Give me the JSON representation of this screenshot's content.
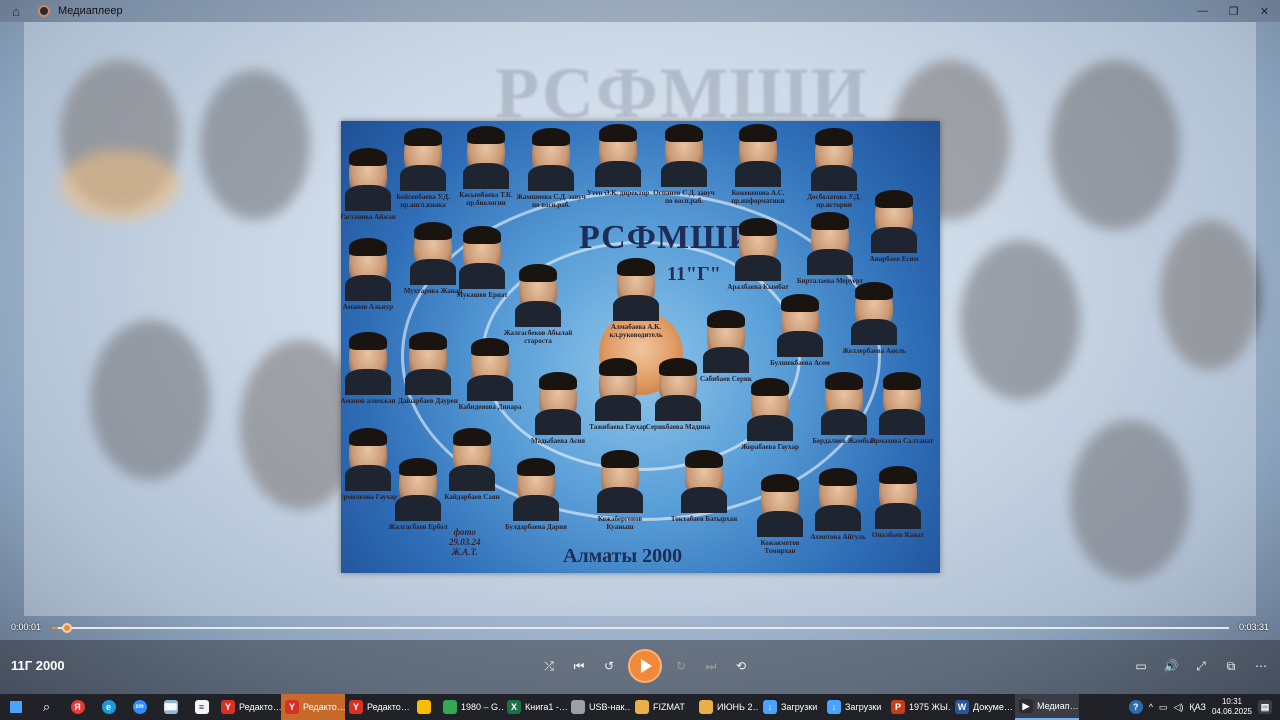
{
  "window": {
    "title": "Медиаплеер"
  },
  "photo": {
    "school": "РСФМШИ",
    "class": "11\"Г\"",
    "city": "Алматы 2000",
    "date_lines": [
      "фото",
      "29.03.24",
      "Ж.А.Т."
    ],
    "people": [
      {
        "name": "Гастанова Айжан"
      },
      {
        "name": "Бейсенбаева У.Д. пр.англ.языка"
      },
      {
        "name": "Касымбаева Т.К. пр.биологии"
      },
      {
        "name": "Жамшиева С.Д. завуч по восп.раб."
      },
      {
        "name": "Утен Ә.К. директор"
      },
      {
        "name": "Оспанов С.Д. завуч по восп.раб."
      },
      {
        "name": "Кожекенова А.С. пр.информатики"
      },
      {
        "name": "Досболатова У.Д. пр.истории"
      },
      {
        "name": "Анарбаев Есим"
      },
      {
        "name": "Аманов Альнур"
      },
      {
        "name": "Мухтарова Жанар"
      },
      {
        "name": "Мукашев Ернат"
      },
      {
        "name": "Жалгасбеков Абылай староста"
      },
      {
        "name": "Алмабаева А.К. кл.руководитель"
      },
      {
        "name": "Аралбаева Кымбат"
      },
      {
        "name": "Бирталаева Меруерт"
      },
      {
        "name": "Аманов алимжан"
      },
      {
        "name": "Дайырбаев Даурен"
      },
      {
        "name": "Кабиденова Динара"
      },
      {
        "name": "Мадыбаева Асия"
      },
      {
        "name": "Тажибаева Гаухар"
      },
      {
        "name": "Серикбаева Мадина"
      },
      {
        "name": "Сабибаев Серик"
      },
      {
        "name": "Булшекбаева Асем"
      },
      {
        "name": "Желлербаева Анель"
      },
      {
        "name": "Жорабаева Гаухар"
      },
      {
        "name": "Бердалиев Жамбыл"
      },
      {
        "name": "Ермахова Салтанат"
      },
      {
        "name": "Ермолкова Гаухар"
      },
      {
        "name": "Жалгасбаев Ербол"
      },
      {
        "name": "Кайдарбаев Саян"
      },
      {
        "name": "Булдарбаева Дария"
      },
      {
        "name": "Кожабергенов Куаныш"
      },
      {
        "name": "Токтабаев Батырхан"
      },
      {
        "name": "Кожакметов Темирхан"
      },
      {
        "name": "Ахметова Айгуль"
      },
      {
        "name": "Оналбаев Канат"
      }
    ]
  },
  "player": {
    "media_title": "11Г 2000",
    "time_elapsed": "0:00:01",
    "time_total": "0:03:31",
    "progress": 0.005,
    "accent_color": "#f08a3a"
  },
  "controls": {
    "center": [
      {
        "name": "shuffle-icon",
        "glyph": "⤮"
      },
      {
        "name": "previous-icon",
        "glyph": "⏮"
      },
      {
        "name": "rewind-10-icon",
        "glyph": "↺"
      },
      {
        "name": "play-icon",
        "glyph": ""
      },
      {
        "name": "forward-30-icon",
        "glyph": "↻"
      },
      {
        "name": "next-icon",
        "glyph": "⏭"
      },
      {
        "name": "repeat-off-icon",
        "glyph": "⟲"
      }
    ],
    "right": [
      {
        "name": "miniplayer-icon",
        "glyph": "▭"
      },
      {
        "name": "volume-icon",
        "glyph": "🔊"
      },
      {
        "name": "fullscreen-icon",
        "glyph": "⤢"
      },
      {
        "name": "cast-icon",
        "glyph": "⧉"
      },
      {
        "name": "more-icon",
        "glyph": "⋯"
      }
    ]
  },
  "taskbar": {
    "apps": [
      {
        "label": "Редакто…",
        "color": "#d93025",
        "letter": "Y",
        "state": "normal"
      },
      {
        "label": "Редакто…",
        "color": "#d93025",
        "letter": "Y",
        "state": "highlight"
      },
      {
        "label": "Редакто…",
        "color": "#d93025",
        "letter": "Y",
        "state": "normal"
      },
      {
        "label": "",
        "color": "#fbbc04",
        "letter": "",
        "state": "normal"
      },
      {
        "label": "1980 – G…",
        "color": "#34a853",
        "letter": "",
        "state": "normal"
      },
      {
        "label": "Книга1 -…",
        "color": "#1e7145",
        "letter": "X",
        "state": "normal"
      },
      {
        "label": "USB-нак…",
        "color": "#9aa0a6",
        "letter": "",
        "state": "normal"
      },
      {
        "label": "FIZMAT",
        "color": "#e8b04a",
        "letter": "",
        "state": "normal"
      },
      {
        "label": "ИЮНЬ 2…",
        "color": "#e8b04a",
        "letter": "",
        "state": "normal"
      },
      {
        "label": "Загрузки",
        "color": "#4aa3ff",
        "letter": "↓",
        "state": "normal"
      },
      {
        "label": "Загрузки",
        "color": "#4aa3ff",
        "letter": "↓",
        "state": "normal"
      },
      {
        "label": "1975 ЖЫ…",
        "color": "#c43e1c",
        "letter": "P",
        "state": "normal"
      },
      {
        "label": "Докуме…",
        "color": "#2b579a",
        "letter": "W",
        "state": "normal"
      },
      {
        "label": "Медиап…",
        "color": "#2b2b2b",
        "letter": "▶",
        "state": "active"
      }
    ],
    "language": "ҚАЗ",
    "time": "10:31",
    "date": "04.06.2025"
  }
}
